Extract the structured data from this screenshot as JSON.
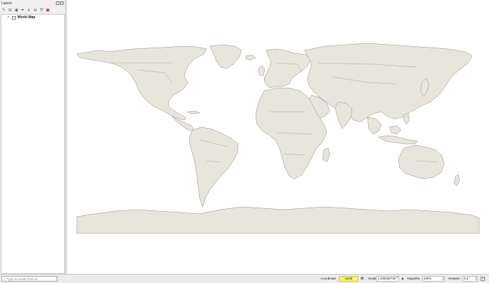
{
  "layers_panel": {
    "title": "Layers",
    "toolbar_icons": [
      "style-manager-icon",
      "add-group-icon",
      "manage-themes-icon",
      "filter-legend-icon",
      "filter-by-expression-icon",
      "expand-all-icon",
      "collapse-all-icon",
      "remove-layer-icon"
    ],
    "layers": [
      {
        "name": "World Map",
        "checked": true,
        "fill_color": "#e8e5dc"
      }
    ]
  },
  "map": {
    "background": "#ffffff",
    "land_color": "#e8e5dc",
    "border_color": "#8a8a85"
  },
  "status_bar": {
    "locator_placeholder": "Type to locate (Ctrl+K)",
    "coordinate_label": "Coordinate",
    "coordinate_value": "world",
    "scale_label": "Scale",
    "scale_value": "1:109458736",
    "magnifier_label": "Magnifier",
    "magnifier_value": "100%",
    "rotation_label": "Rotation",
    "rotation_value": "0.0 °",
    "render_checked": true,
    "coordinate_highlight": "#ffff40"
  }
}
